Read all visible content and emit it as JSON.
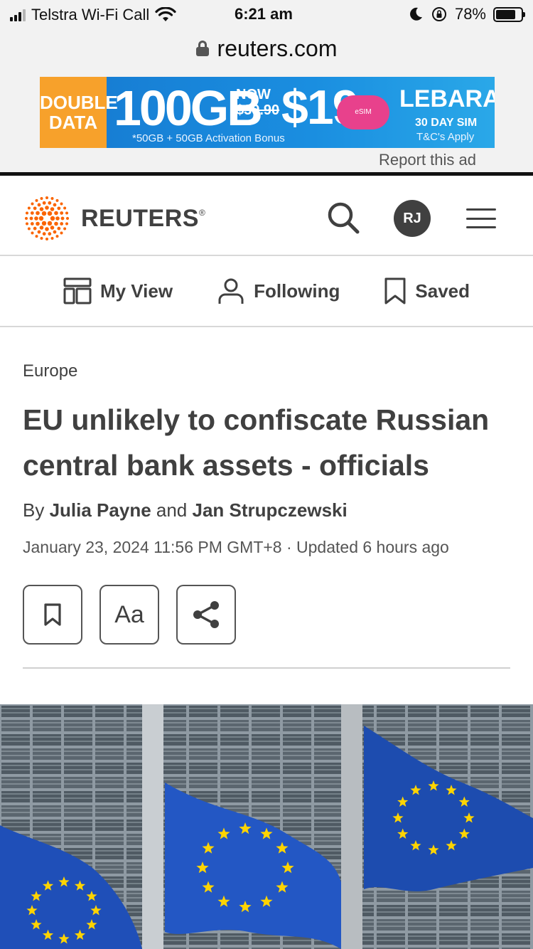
{
  "status_bar": {
    "carrier": "Telstra Wi-Fi Call",
    "time": "6:21 am",
    "battery": "78%",
    "battery_level": 0.78
  },
  "url_bar": {
    "domain": "reuters.com"
  },
  "ad": {
    "double": "DOUBLE",
    "data": "DATA",
    "gb": "100GB",
    "now": "NOW",
    "old_price": "$39.90",
    "price": "$19",
    "esim": "eSIM",
    "brand": "LEBARA",
    "sim": "30 DAY SIM",
    "tc": "T&C's Apply",
    "bonus": "*50GB + 50GB Activation Bonus",
    "report": "Report this ad"
  },
  "header": {
    "logo_text": "REUTERS",
    "avatar_initials": "RJ"
  },
  "subnav": {
    "my_view": "My View",
    "following": "Following",
    "saved": "Saved"
  },
  "article": {
    "section": "Europe",
    "headline": "EU unlikely to confiscate Russian central bank assets - officials",
    "by": "By",
    "author1": "Julia Payne",
    "and": "and",
    "author2": "Jan Strupczewski",
    "dateline": "January 23, 2024 11:56 PM GMT+8 · Updated 6 hours ago",
    "text_size_label": "Aa"
  },
  "colors": {
    "accent": "#fa6400",
    "text": "#404040",
    "eu_blue": "#1f4fb8",
    "eu_star": "#ffd400"
  }
}
